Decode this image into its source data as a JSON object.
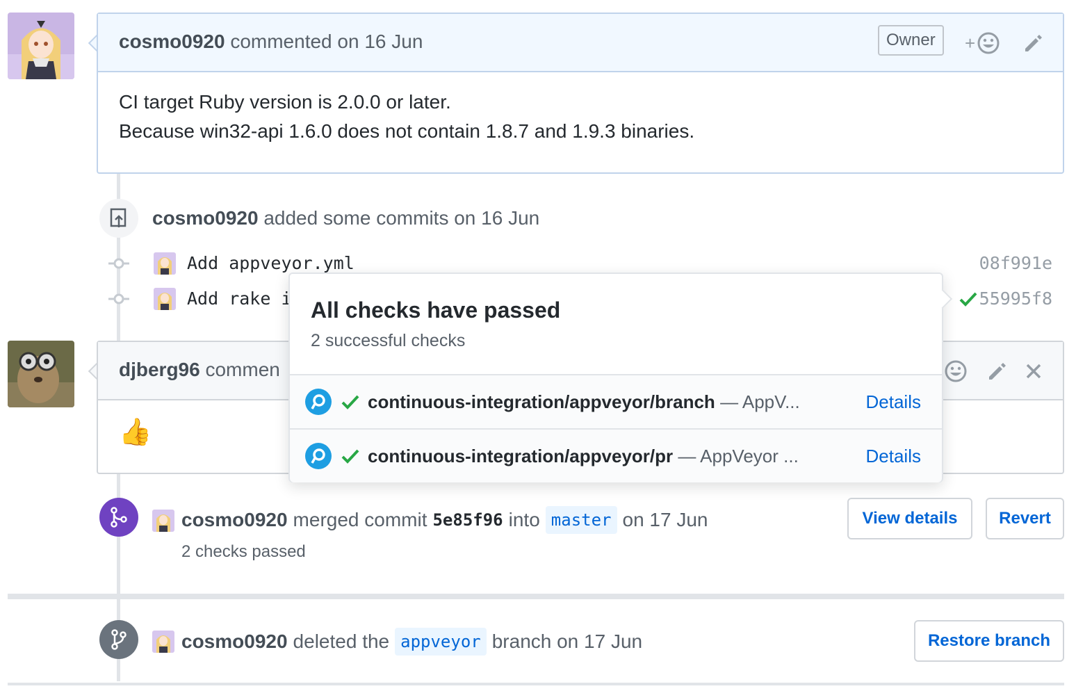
{
  "comment1": {
    "author": "cosmo0920",
    "meta": "commented on 16 Jun",
    "role": "Owner",
    "reaction_plus": "+",
    "body_lines": [
      "CI target Ruby version is 2.0.0 or later.",
      "Because win32-api 1.6.0 does not contain 1.8.7 and 1.9.3 binaries."
    ]
  },
  "commits_event": {
    "author": "cosmo0920",
    "text": "added some commits on 16 Jun",
    "commits": [
      {
        "message": "Add appveyor.yml",
        "sha": "08f991e"
      },
      {
        "message": "Add rake i",
        "sha": "55995f8"
      }
    ]
  },
  "comment2": {
    "author": "djberg96",
    "meta": "commen",
    "body": "👍"
  },
  "popover": {
    "title": "All checks have passed",
    "subtitle": "2 successful checks",
    "checks": [
      {
        "name": "continuous-integration/appveyor/branch",
        "desc": "— AppV...",
        "link": "Details"
      },
      {
        "name": "continuous-integration/appveyor/pr",
        "desc": "— AppVeyor ...",
        "link": "Details"
      }
    ]
  },
  "merge_event": {
    "author": "cosmo0920",
    "text1": "merged commit",
    "sha": "5e85f96",
    "text2": "into",
    "branch": "master",
    "text3": "on 17 Jun",
    "checks_text": "2 checks passed",
    "view_details": "View details",
    "revert": "Revert"
  },
  "delete_event": {
    "author": "cosmo0920",
    "text1": "deleted the",
    "branch": "appveyor",
    "text2": "branch on 17 Jun",
    "restore": "Restore branch"
  },
  "colors": {
    "link": "#0366d6",
    "success": "#28a745",
    "merged": "#6f42c1",
    "owner_header": "#f1f8ff",
    "appveyor": "#1e9ee2"
  },
  "icons": [
    "smiley-icon",
    "pencil-icon",
    "close-icon",
    "git-commit-icon",
    "repo-push-icon",
    "git-merge-icon",
    "git-branch-icon",
    "check-icon",
    "appveyor-icon"
  ]
}
